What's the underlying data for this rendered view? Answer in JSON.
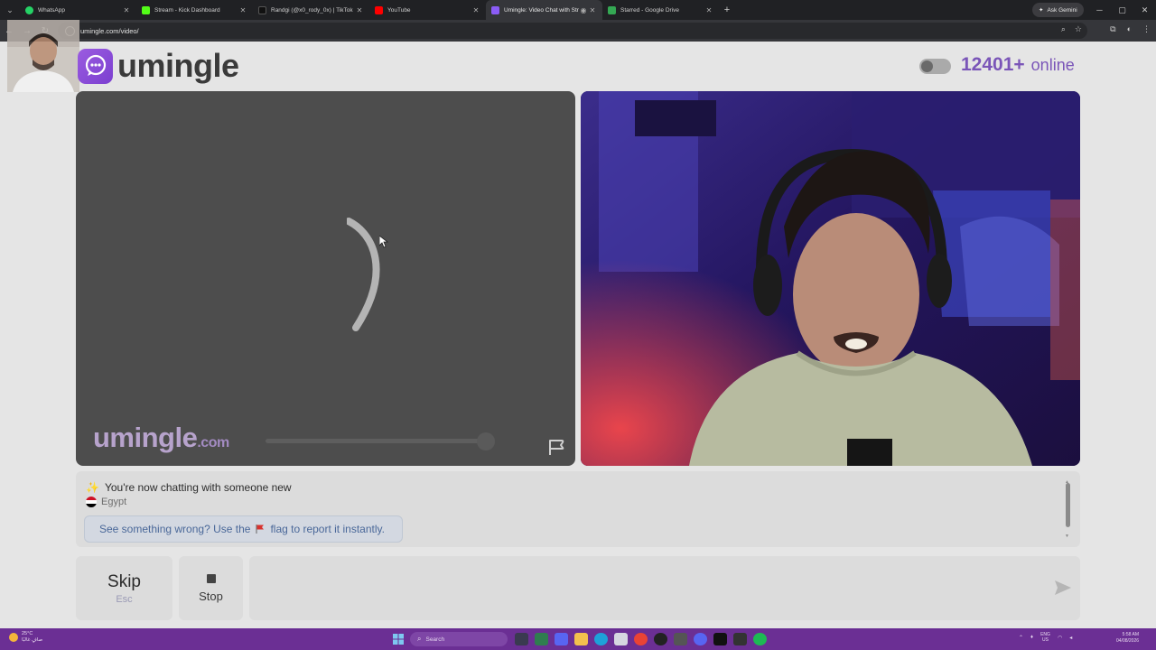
{
  "browser": {
    "tabs": [
      {
        "label": "WhatsApp",
        "favicon_color": "#25d366",
        "active": false
      },
      {
        "label": "Stream - Kick Dashboard",
        "favicon_color": "#53fc18",
        "active": false
      },
      {
        "label": "Randgi (@x0_rody_0x) | TikTok",
        "favicon_color": "#111111",
        "active": false
      },
      {
        "label": "YouTube",
        "favicon_color": "#ff0000",
        "active": false
      },
      {
        "label": "Umingle: Video Chat with Str…",
        "favicon_color": "#8b5cf6",
        "active": true
      },
      {
        "label": "Starred - Google Drive",
        "favicon_color": "#34a853",
        "active": false
      }
    ],
    "ask_gemini": "Ask Gemini",
    "url": "umingle.com/video/"
  },
  "site": {
    "name": "umingle",
    "online_count": "12401+",
    "online_label": "online",
    "watermark": "umingle",
    "watermark_suffix": ".com",
    "accent_color": "#7a55b8"
  },
  "chat": {
    "status_emoji": "✨",
    "status": "You're now chatting with someone new",
    "country": "Egypt",
    "report_before": "See something wrong? Use the",
    "report_after": "flag to report it instantly."
  },
  "controls": {
    "skip_label": "Skip",
    "skip_hint": "Esc",
    "stop_label": "Stop",
    "message_placeholder": ""
  },
  "taskbar": {
    "weather_temp": "25°C",
    "weather_desc": "صافٍ غالبًا",
    "search_label": "Search",
    "lang_top": "ENG",
    "lang_bottom": "US",
    "time": "5:58 AM",
    "date": "04/08/2026"
  }
}
